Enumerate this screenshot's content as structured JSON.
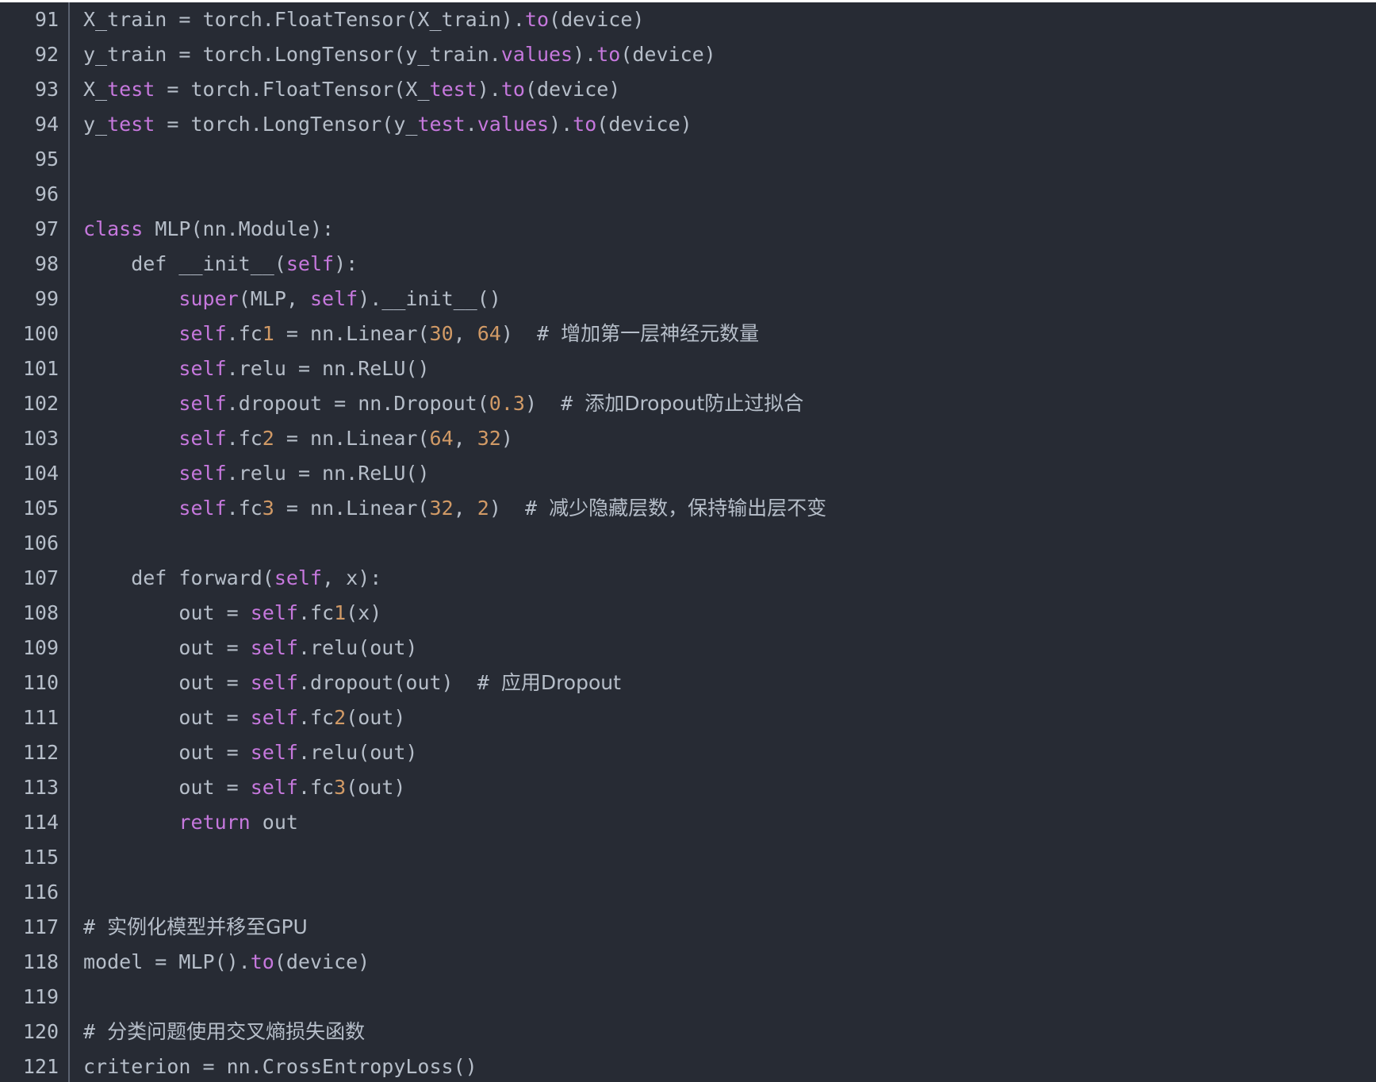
{
  "theme": {
    "background": "#272b34",
    "text": "#b6bec9",
    "keyword": "#c678dd",
    "number": "#d19a66",
    "gutter_divider": "#5b6270"
  },
  "lines": [
    {
      "num": "91",
      "tokens": [
        {
          "t": "X_train = torch.FloatTensor(X_train).",
          "c": "plain"
        },
        {
          "t": "to",
          "c": "keyword"
        },
        {
          "t": "(device)",
          "c": "plain"
        }
      ]
    },
    {
      "num": "92",
      "tokens": [
        {
          "t": "y_train = torch.LongTensor(y_train.",
          "c": "plain"
        },
        {
          "t": "values",
          "c": "keyword"
        },
        {
          "t": ").",
          "c": "plain"
        },
        {
          "t": "to",
          "c": "keyword"
        },
        {
          "t": "(device)",
          "c": "plain"
        }
      ]
    },
    {
      "num": "93",
      "tokens": [
        {
          "t": "X_",
          "c": "plain"
        },
        {
          "t": "test",
          "c": "keyword"
        },
        {
          "t": " = torch.FloatTensor(X_",
          "c": "plain"
        },
        {
          "t": "test",
          "c": "keyword"
        },
        {
          "t": ").",
          "c": "plain"
        },
        {
          "t": "to",
          "c": "keyword"
        },
        {
          "t": "(device)",
          "c": "plain"
        }
      ]
    },
    {
      "num": "94",
      "tokens": [
        {
          "t": "y_",
          "c": "plain"
        },
        {
          "t": "test",
          "c": "keyword"
        },
        {
          "t": " = torch.LongTensor(y_",
          "c": "plain"
        },
        {
          "t": "test",
          "c": "keyword"
        },
        {
          "t": ".",
          "c": "plain"
        },
        {
          "t": "values",
          "c": "keyword"
        },
        {
          "t": ").",
          "c": "plain"
        },
        {
          "t": "to",
          "c": "keyword"
        },
        {
          "t": "(device)",
          "c": "plain"
        }
      ]
    },
    {
      "num": "95",
      "tokens": []
    },
    {
      "num": "96",
      "tokens": []
    },
    {
      "num": "97",
      "tokens": [
        {
          "t": "class",
          "c": "keyword"
        },
        {
          "t": " MLP(nn.Module):",
          "c": "plain"
        }
      ]
    },
    {
      "num": "98",
      "tokens": [
        {
          "t": "    def __init__(",
          "c": "plain"
        },
        {
          "t": "self",
          "c": "keyword"
        },
        {
          "t": "):",
          "c": "plain"
        }
      ]
    },
    {
      "num": "99",
      "tokens": [
        {
          "t": "        ",
          "c": "plain"
        },
        {
          "t": "super",
          "c": "keyword"
        },
        {
          "t": "(MLP, ",
          "c": "plain"
        },
        {
          "t": "self",
          "c": "keyword"
        },
        {
          "t": ").__init__()",
          "c": "plain"
        }
      ]
    },
    {
      "num": "100",
      "tokens": [
        {
          "t": "        ",
          "c": "plain"
        },
        {
          "t": "self",
          "c": "keyword"
        },
        {
          "t": ".fc",
          "c": "plain"
        },
        {
          "t": "1",
          "c": "number"
        },
        {
          "t": " = nn.Linear(",
          "c": "plain"
        },
        {
          "t": "30",
          "c": "number"
        },
        {
          "t": ", ",
          "c": "plain"
        },
        {
          "t": "64",
          "c": "number"
        },
        {
          "t": ")  # ",
          "c": "plain"
        },
        {
          "t": "增加第一层神经元数量",
          "c": "cjk"
        }
      ]
    },
    {
      "num": "101",
      "tokens": [
        {
          "t": "        ",
          "c": "plain"
        },
        {
          "t": "self",
          "c": "keyword"
        },
        {
          "t": ".relu = nn.ReLU()",
          "c": "plain"
        }
      ]
    },
    {
      "num": "102",
      "tokens": [
        {
          "t": "        ",
          "c": "plain"
        },
        {
          "t": "self",
          "c": "keyword"
        },
        {
          "t": ".dropout = nn.Dropout(",
          "c": "plain"
        },
        {
          "t": "0.3",
          "c": "number"
        },
        {
          "t": ")  # ",
          "c": "plain"
        },
        {
          "t": "添加Dropout防止过拟合",
          "c": "cjk"
        }
      ]
    },
    {
      "num": "103",
      "tokens": [
        {
          "t": "        ",
          "c": "plain"
        },
        {
          "t": "self",
          "c": "keyword"
        },
        {
          "t": ".fc",
          "c": "plain"
        },
        {
          "t": "2",
          "c": "number"
        },
        {
          "t": " = nn.Linear(",
          "c": "plain"
        },
        {
          "t": "64",
          "c": "number"
        },
        {
          "t": ", ",
          "c": "plain"
        },
        {
          "t": "32",
          "c": "number"
        },
        {
          "t": ")",
          "c": "plain"
        }
      ]
    },
    {
      "num": "104",
      "tokens": [
        {
          "t": "        ",
          "c": "plain"
        },
        {
          "t": "self",
          "c": "keyword"
        },
        {
          "t": ".relu = nn.ReLU()",
          "c": "plain"
        }
      ]
    },
    {
      "num": "105",
      "tokens": [
        {
          "t": "        ",
          "c": "plain"
        },
        {
          "t": "self",
          "c": "keyword"
        },
        {
          "t": ".fc",
          "c": "plain"
        },
        {
          "t": "3",
          "c": "number"
        },
        {
          "t": " = nn.Linear(",
          "c": "plain"
        },
        {
          "t": "32",
          "c": "number"
        },
        {
          "t": ", ",
          "c": "plain"
        },
        {
          "t": "2",
          "c": "number"
        },
        {
          "t": ")  # ",
          "c": "plain"
        },
        {
          "t": "减少隐藏层数，保持输出层不变",
          "c": "cjk"
        }
      ]
    },
    {
      "num": "106",
      "tokens": []
    },
    {
      "num": "107",
      "tokens": [
        {
          "t": "    def forward(",
          "c": "plain"
        },
        {
          "t": "self",
          "c": "keyword"
        },
        {
          "t": ", x):",
          "c": "plain"
        }
      ]
    },
    {
      "num": "108",
      "tokens": [
        {
          "t": "        out = ",
          "c": "plain"
        },
        {
          "t": "self",
          "c": "keyword"
        },
        {
          "t": ".fc",
          "c": "plain"
        },
        {
          "t": "1",
          "c": "number"
        },
        {
          "t": "(x)",
          "c": "plain"
        }
      ]
    },
    {
      "num": "109",
      "tokens": [
        {
          "t": "        out = ",
          "c": "plain"
        },
        {
          "t": "self",
          "c": "keyword"
        },
        {
          "t": ".relu(out)",
          "c": "plain"
        }
      ]
    },
    {
      "num": "110",
      "tokens": [
        {
          "t": "        out = ",
          "c": "plain"
        },
        {
          "t": "self",
          "c": "keyword"
        },
        {
          "t": ".dropout(out)  # ",
          "c": "plain"
        },
        {
          "t": "应用Dropout",
          "c": "cjk"
        }
      ]
    },
    {
      "num": "111",
      "tokens": [
        {
          "t": "        out = ",
          "c": "plain"
        },
        {
          "t": "self",
          "c": "keyword"
        },
        {
          "t": ".fc",
          "c": "plain"
        },
        {
          "t": "2",
          "c": "number"
        },
        {
          "t": "(out)",
          "c": "plain"
        }
      ]
    },
    {
      "num": "112",
      "tokens": [
        {
          "t": "        out = ",
          "c": "plain"
        },
        {
          "t": "self",
          "c": "keyword"
        },
        {
          "t": ".relu(out)",
          "c": "plain"
        }
      ]
    },
    {
      "num": "113",
      "tokens": [
        {
          "t": "        out = ",
          "c": "plain"
        },
        {
          "t": "self",
          "c": "keyword"
        },
        {
          "t": ".fc",
          "c": "plain"
        },
        {
          "t": "3",
          "c": "number"
        },
        {
          "t": "(out)",
          "c": "plain"
        }
      ]
    },
    {
      "num": "114",
      "tokens": [
        {
          "t": "        ",
          "c": "plain"
        },
        {
          "t": "return",
          "c": "keyword"
        },
        {
          "t": " out",
          "c": "plain"
        }
      ]
    },
    {
      "num": "115",
      "tokens": []
    },
    {
      "num": "116",
      "tokens": []
    },
    {
      "num": "117",
      "tokens": [
        {
          "t": "# ",
          "c": "plain"
        },
        {
          "t": "实例化模型并移至GPU",
          "c": "cjk"
        }
      ]
    },
    {
      "num": "118",
      "tokens": [
        {
          "t": "model = MLP().",
          "c": "plain"
        },
        {
          "t": "to",
          "c": "keyword"
        },
        {
          "t": "(device)",
          "c": "plain"
        }
      ]
    },
    {
      "num": "119",
      "tokens": []
    },
    {
      "num": "120",
      "tokens": [
        {
          "t": "# ",
          "c": "plain"
        },
        {
          "t": "分类问题使用交叉熵损失函数",
          "c": "cjk"
        }
      ]
    },
    {
      "num": "121",
      "tokens": [
        {
          "t": "criterion = nn.CrossEntropyLoss()",
          "c": "plain"
        }
      ]
    }
  ]
}
